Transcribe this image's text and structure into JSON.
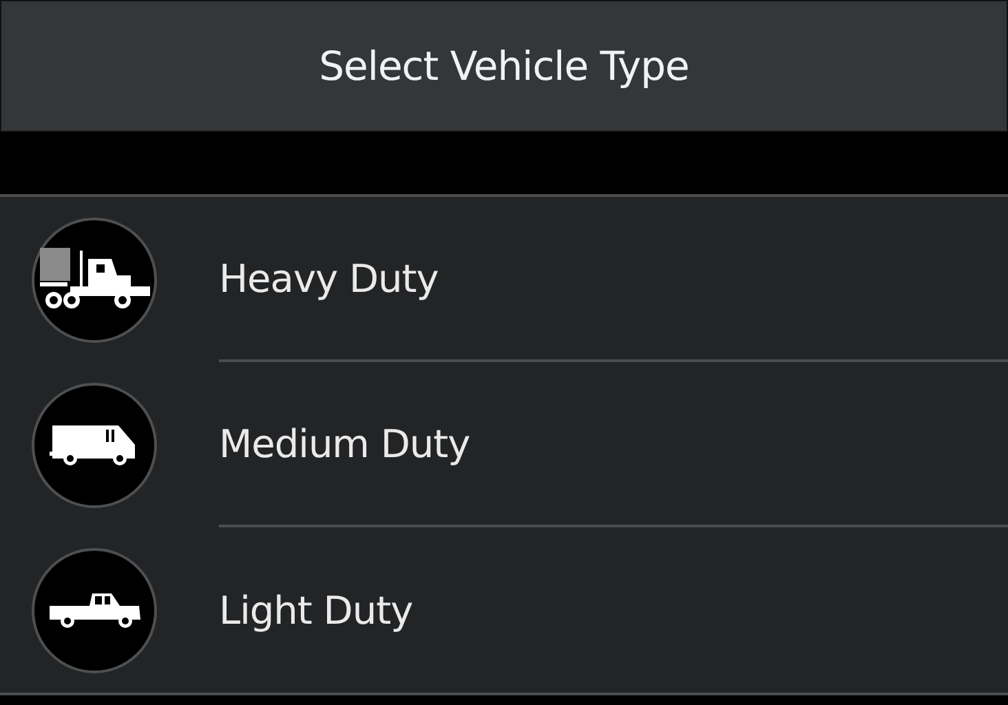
{
  "header": {
    "title": "Select Vehicle Type"
  },
  "options": [
    {
      "label": "Heavy Duty",
      "kind": "truck"
    },
    {
      "label": "Medium Duty",
      "kind": "van"
    },
    {
      "label": "Light Duty",
      "kind": "pickup"
    }
  ]
}
